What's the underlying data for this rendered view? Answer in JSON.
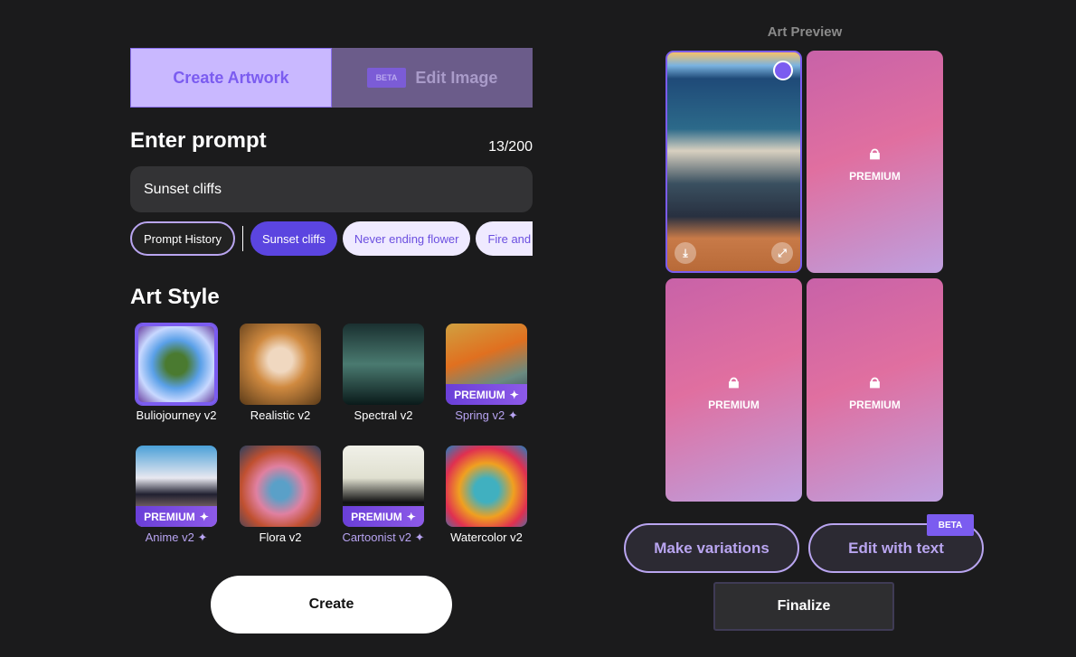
{
  "tabs": {
    "create": "Create Artwork",
    "edit": "Edit Image",
    "edit_badge": "BETA"
  },
  "prompt": {
    "heading": "Enter prompt",
    "counter": "13/200",
    "value": "Sunset cliffs"
  },
  "chips": {
    "history": "Prompt History",
    "items": [
      "Sunset cliffs",
      "Never ending flower",
      "Fire and water"
    ]
  },
  "art_style": {
    "heading": "Art Style",
    "premium_label": "PREMIUM",
    "items": [
      {
        "label": "Buliojourney v2",
        "premium": false,
        "selected": true
      },
      {
        "label": "Realistic v2",
        "premium": false
      },
      {
        "label": "Spectral v2",
        "premium": false
      },
      {
        "label": "Spring v2",
        "premium": true
      },
      {
        "label": "Anime v2",
        "premium": true
      },
      {
        "label": "Flora v2",
        "premium": false
      },
      {
        "label": "Cartoonist v2",
        "premium": true
      },
      {
        "label": "Watercolor v2",
        "premium": false
      }
    ]
  },
  "create_label": "Create",
  "preview": {
    "title": "Art Preview",
    "locked_label": "PREMIUM"
  },
  "actions": {
    "variations": "Make variations",
    "edit_text": "Edit with text",
    "edit_badge": "BETA",
    "finalize": "Finalize"
  },
  "colors": {
    "accent": "#7b5cf0",
    "background": "#1b1b1c",
    "chip_selected": "#5b45e0"
  }
}
